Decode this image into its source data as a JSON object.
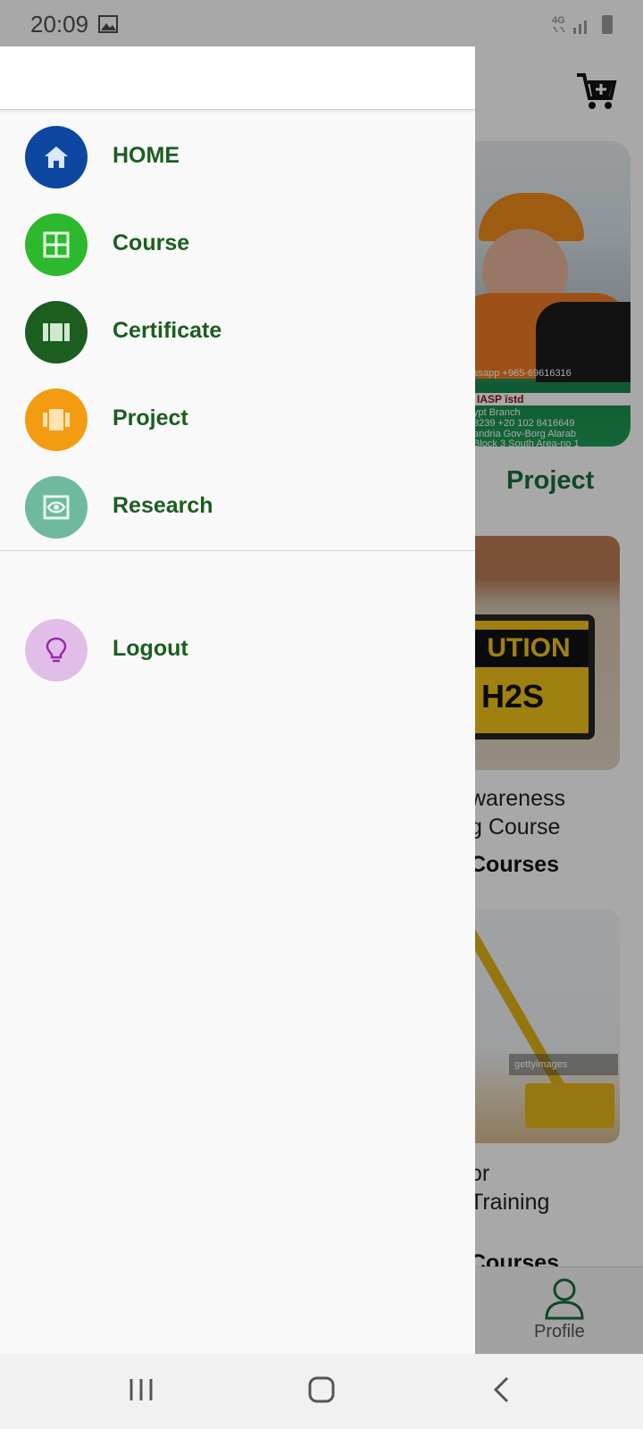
{
  "status_bar": {
    "time": "20:09",
    "network": "4G",
    "icons": [
      "gallery-icon",
      "signal-icon",
      "battery-icon"
    ]
  },
  "drawer": {
    "items": [
      {
        "label": "HOME",
        "icon": "home-icon",
        "color": "#0d47a1"
      },
      {
        "label": "Course",
        "icon": "grid-icon",
        "color": "#2eb82e"
      },
      {
        "label": "Certificate",
        "icon": "certificate-icon",
        "color": "#1b5e20"
      },
      {
        "label": "Project",
        "icon": "project-icon",
        "color": "#f39c12"
      },
      {
        "label": "Research",
        "icon": "eye-icon",
        "color": "#6fba9c"
      }
    ],
    "logout": {
      "label": "Logout",
      "icon": "lightbulb-icon",
      "color": "#e1bee7"
    }
  },
  "background": {
    "banner": {
      "line1": "ssapp +965-69616316",
      "logos": "IASP  ïstd",
      "line2": "ypt Branch",
      "line3": "3239  +20 102 8416649",
      "line4": "andria Gov-Borg Alarab",
      "line5": "Block 3 South Area-no 1"
    },
    "section_title": "Project",
    "cards": [
      {
        "sign": "UTION",
        "sign_sub": "H2S",
        "line1": "wareness",
        "line2": "g Course",
        "category": "Courses"
      },
      {
        "watermark": "gettyimages",
        "line1": "or",
        "line2": "Training",
        "category": "Courses"
      }
    ],
    "bottom_nav": {
      "profile_label": "Profile"
    }
  },
  "colors": {
    "accent_green": "#1b5e20",
    "brand_green": "#1b6e3a"
  }
}
